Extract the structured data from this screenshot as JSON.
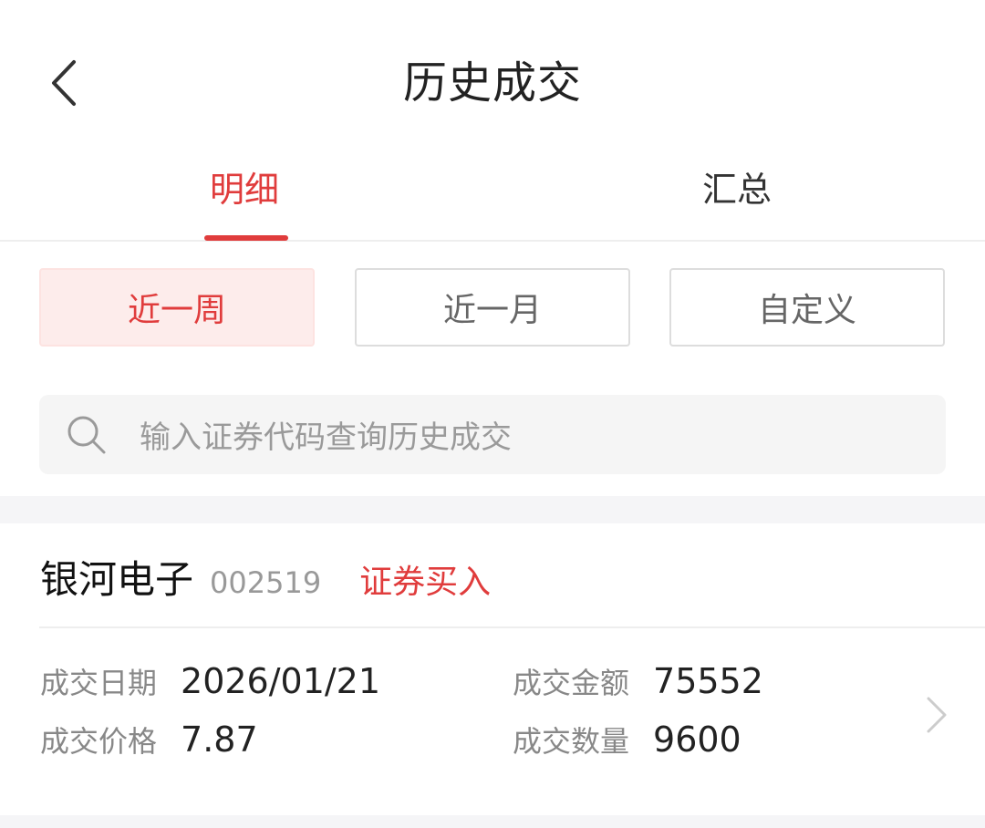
{
  "header": {
    "title": "历史成交",
    "back_icon": "chevron-left-icon"
  },
  "tabs": {
    "items": [
      {
        "label": "明细",
        "active": true
      },
      {
        "label": "汇总",
        "active": false
      }
    ]
  },
  "filters": {
    "items": [
      {
        "label": "近一周",
        "active": true
      },
      {
        "label": "近一月",
        "active": false
      },
      {
        "label": "自定义",
        "active": false
      }
    ]
  },
  "search": {
    "icon": "search-icon",
    "placeholder": "输入证券代码查询历史成交"
  },
  "records": [
    {
      "stock_name": "银河电子",
      "stock_code": "002519",
      "trade_type": "证券买入",
      "fields": [
        {
          "label": "成交日期",
          "value": "2026/01/21"
        },
        {
          "label": "成交金额",
          "value": "75552"
        },
        {
          "label": "成交价格",
          "value": "7.87"
        },
        {
          "label": "成交数量",
          "value": "9600"
        }
      ],
      "chevron_icon": "chevron-right-icon"
    }
  ],
  "colors": {
    "accent": "#e03c3c",
    "active_bg": "#fdeceb",
    "muted_text": "#888888",
    "separator_bg": "#f5f5f7"
  }
}
